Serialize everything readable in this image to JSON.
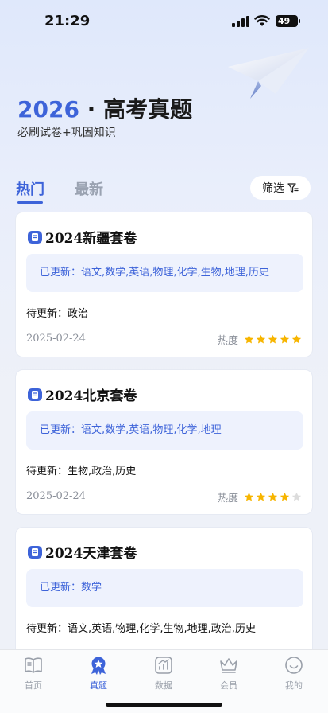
{
  "status_bar": {
    "time": "21:29",
    "battery": "49"
  },
  "hero": {
    "year": "2026",
    "title_rest": " · 高考真题",
    "subtitle": "必刷试卷+巩固知识"
  },
  "tabs": {
    "hot": "热门",
    "latest": "最新"
  },
  "filter": {
    "label": "筛选",
    "icon": "filter-icon"
  },
  "cards": [
    {
      "title": "2024新疆套卷",
      "updated_label": "已更新：",
      "updated": "语文,数学,英语,物理,化学,生物,地理,历史",
      "pending_label": "待更新：",
      "pending": "政治",
      "date": "2025-02-24",
      "heat_label": "热度",
      "stars": 5
    },
    {
      "title": "2024北京套卷",
      "updated_label": "已更新：",
      "updated": "语文,数学,英语,物理,化学,地理",
      "pending_label": "待更新：",
      "pending": "生物,政治,历史",
      "date": "2025-02-24",
      "heat_label": "热度",
      "stars": 4
    },
    {
      "title": "2024天津套卷",
      "updated_label": "已更新：",
      "updated": "数学",
      "pending_label": "待更新：",
      "pending": "语文,英语,物理,化学,生物,地理,政治,历史",
      "date": "",
      "heat_label": "",
      "stars": 0
    }
  ],
  "nav": [
    {
      "label": "首页",
      "icon": "book-icon"
    },
    {
      "label": "真题",
      "icon": "medal-icon",
      "active": true
    },
    {
      "label": "数据",
      "icon": "chart-icon"
    },
    {
      "label": "会员",
      "icon": "crown-icon"
    },
    {
      "label": "我的",
      "icon": "smiley-icon"
    }
  ],
  "colors": {
    "accent": "#3d63d9",
    "star": "#f7b500",
    "star_empty": "#dcdcdc"
  }
}
